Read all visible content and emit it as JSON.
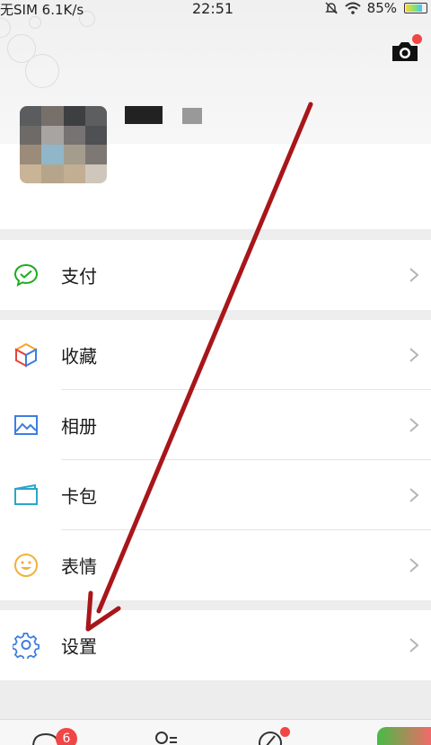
{
  "status_bar": {
    "carrier": "无SIM 6.1K/s",
    "time": "22:51",
    "battery": "85%",
    "battery_fraction": 0.85
  },
  "header": {
    "camera_icon": "camera-icon"
  },
  "menu": {
    "pay": {
      "label": "支付",
      "icon": "wallet-icon"
    },
    "favorites": {
      "label": "收藏",
      "icon": "cube-icon"
    },
    "album": {
      "label": "相册",
      "icon": "image-icon"
    },
    "cards": {
      "label": "卡包",
      "icon": "card-icon"
    },
    "stickers": {
      "label": "表情",
      "icon": "smile-icon"
    },
    "settings": {
      "label": "设置",
      "icon": "gear-icon"
    }
  },
  "tabbar": {
    "chats_badge": "6"
  },
  "colors": {
    "accent_green": "#1aad19",
    "badge_red": "#f04646",
    "arrow_red": "#a8161a"
  }
}
